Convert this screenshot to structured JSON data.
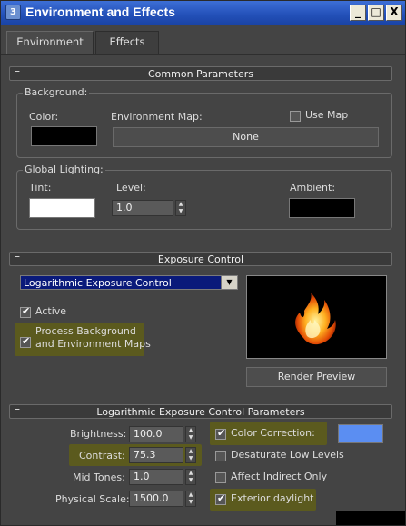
{
  "window": {
    "title": "Environment and Effects",
    "app_icon": "3ds-max-icon"
  },
  "title_buttons": {
    "minimize": "_",
    "maximize": "□",
    "close": "X"
  },
  "tabs": [
    {
      "label": "Environment",
      "active": true
    },
    {
      "label": "Effects",
      "active": false
    }
  ],
  "common": {
    "rollout_title": "Common Parameters",
    "rollout_toggle": "–",
    "background": {
      "group_label": "Background:",
      "color_label": "Color:",
      "color": "#000000",
      "env_map_label": "Environment Map:",
      "use_map_label": "Use Map",
      "use_map_checked": false,
      "env_map_button": "None"
    },
    "lighting": {
      "group_label": "Global Lighting:",
      "tint_label": "Tint:",
      "tint_color": "#ffffff",
      "level_label": "Level:",
      "level_value": "1.0",
      "ambient_label": "Ambient:",
      "ambient_color": "#000000"
    }
  },
  "exposure": {
    "rollout_title": "Exposure Control",
    "rollout_toggle": "–",
    "selected_control": "Logarithmic Exposure Control",
    "active_label": "Active",
    "active_checked": true,
    "process_bg_label_line1": "Process Background",
    "process_bg_label_line2": "and Environment Maps",
    "process_bg_checked": true,
    "render_preview_button": "Render Preview"
  },
  "log_params": {
    "rollout_title": "Logarithmic Exposure Control Parameters",
    "rollout_toggle": "–",
    "brightness_label": "Brightness:",
    "brightness_value": "100.0",
    "contrast_label": "Contrast:",
    "contrast_value": "75.3",
    "mid_tones_label": "Mid Tones:",
    "mid_tones_value": "1.0",
    "physical_scale_label": "Physical Scale:",
    "physical_scale_value": "1500.0",
    "color_correction_label": "Color Correction:",
    "color_correction_checked": true,
    "color_correction_color": "#5b8ef2",
    "desaturate_label": "Desaturate Low Levels",
    "desaturate_checked": false,
    "affect_indirect_label": "Affect Indirect Only",
    "affect_indirect_checked": false,
    "exterior_daylight_label": "Exterior daylight",
    "exterior_daylight_checked": true
  },
  "colors": {
    "highlight": "#5b5a1e",
    "panel": "#444444",
    "title_bar": "#2350b8"
  }
}
